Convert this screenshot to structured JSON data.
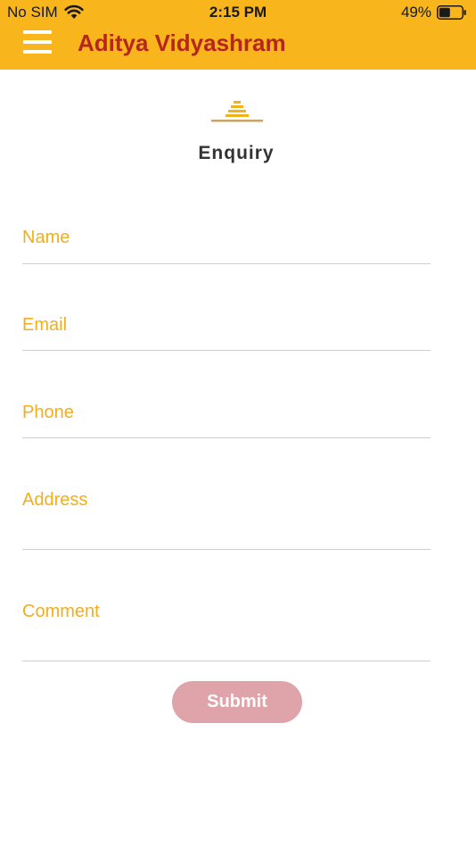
{
  "status_bar": {
    "carrier": "No SIM",
    "time": "2:15 PM",
    "battery_percent": "49%",
    "battery_level": 0.49,
    "wifi_icon": "wifi-icon"
  },
  "app_bar": {
    "title": "Aditya Vidyashram",
    "menu_icon": "hamburger-menu-icon",
    "background_color": "#F9B51C",
    "title_color": "#B7261E"
  },
  "page": {
    "heading": "Enquiry",
    "logo_icon": "stacked-lamp-icon"
  },
  "form": {
    "name_placeholder": "Name",
    "email_placeholder": "Email",
    "phone_placeholder": "Phone",
    "address_placeholder": "Address",
    "comment_placeholder": "Comment",
    "placeholder_color": "#F2AE1C",
    "submit_label": "Submit",
    "submit_color": "#DEA4AA"
  }
}
